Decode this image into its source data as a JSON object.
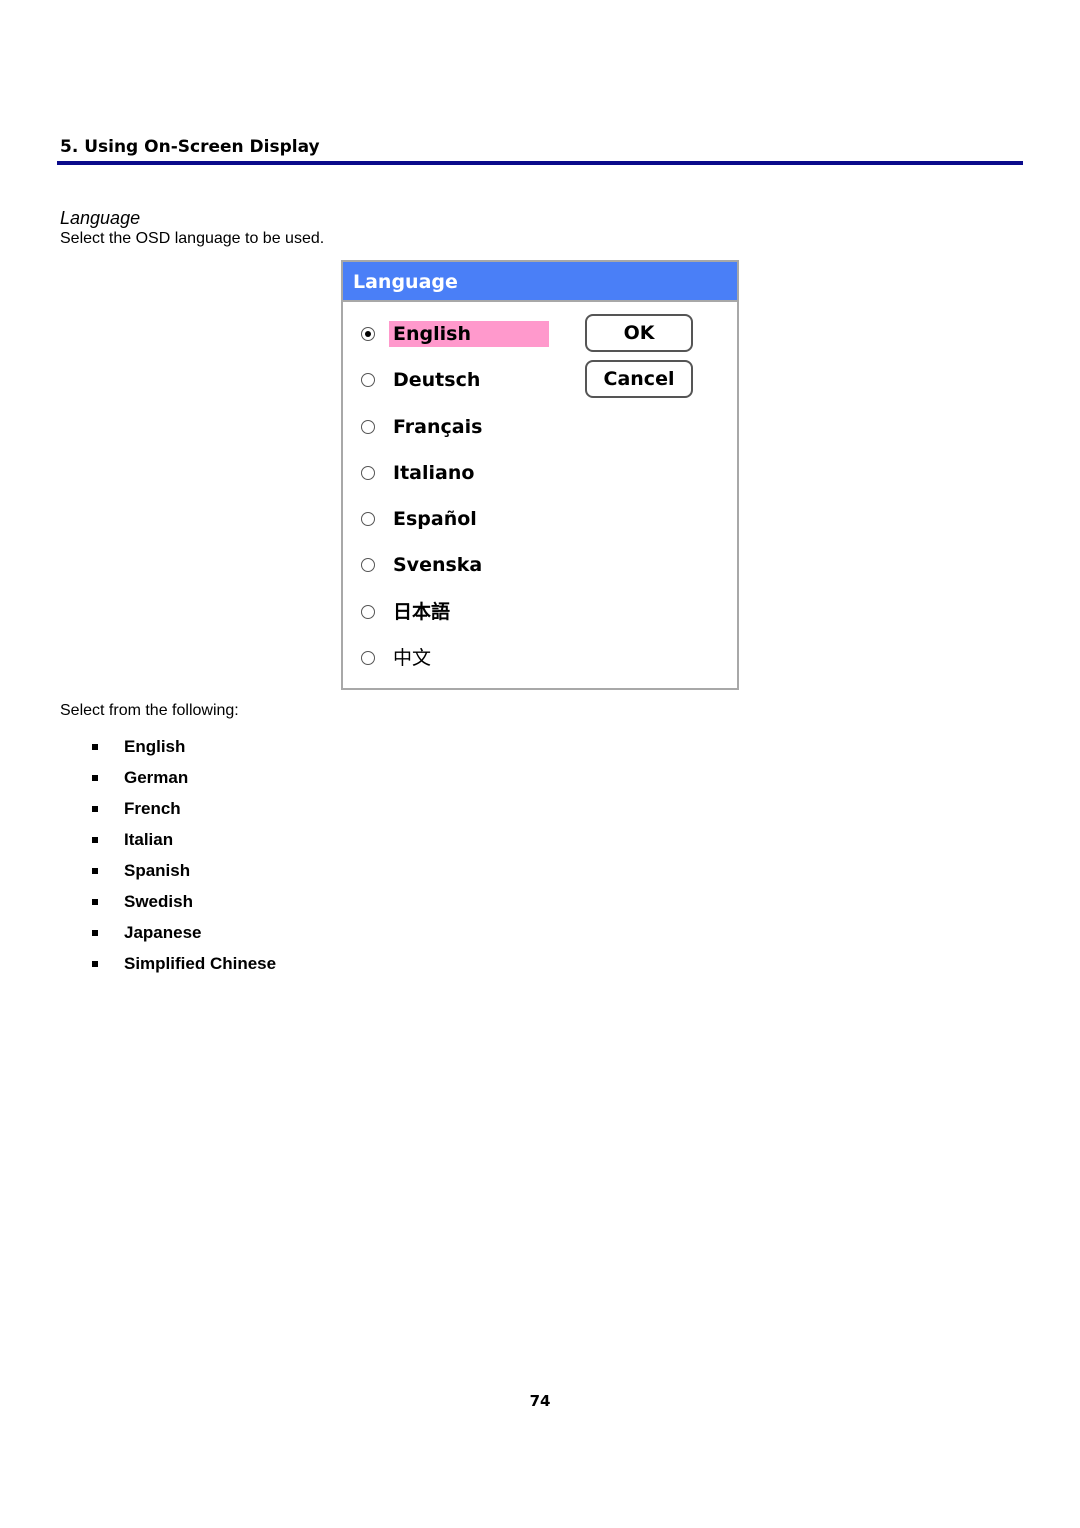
{
  "header": {
    "section_title": "5. Using On-Screen Display",
    "rule_color": "#0a0a8a"
  },
  "content": {
    "subheading": "Language",
    "intro": "Select the OSD language to be used.",
    "list_intro": "Select from the following:",
    "languages": [
      "English",
      "German",
      "French",
      "Italian",
      "Spanish",
      "Swedish",
      "Japanese",
      "Simplified Chinese"
    ]
  },
  "osd": {
    "title": "Language",
    "title_color": "#4a7ff7",
    "highlight_color": "#ff99cc",
    "options": [
      {
        "label": "English",
        "selected": true
      },
      {
        "label": "Deutsch",
        "selected": false
      },
      {
        "label": "Français",
        "selected": false
      },
      {
        "label": "Italiano",
        "selected": false
      },
      {
        "label": "Español",
        "selected": false
      },
      {
        "label": "Svenska",
        "selected": false
      },
      {
        "label": "日本語",
        "selected": false
      },
      {
        "label": "中文",
        "selected": false
      }
    ],
    "ok_label": "OK",
    "cancel_label": "Cancel"
  },
  "footer": {
    "page_number": "74"
  }
}
